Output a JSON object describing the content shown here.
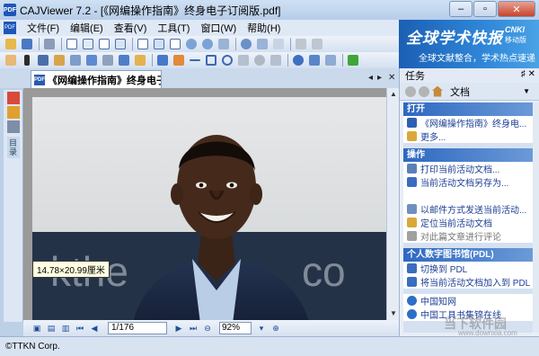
{
  "window": {
    "title": "CAJViewer 7.2 - [《网编操作指南》终身电子订阅版.pdf]",
    "buttons": {
      "minimize": "–",
      "maximize": "▫",
      "close": "✕"
    }
  },
  "menu": [
    "文件(F)",
    "编辑(E)",
    "查看(V)",
    "工具(T)",
    "窗口(W)",
    "帮助(H)"
  ],
  "banner": {
    "title": "全球学术快报",
    "cnki": "CNKI",
    "mobile": "移动版",
    "subtitle": "全球文献整合，学术热点速递"
  },
  "document_tab": {
    "label": "《网编操作指南》终身电子...",
    "close": "✕"
  },
  "left_bar": {
    "label": "目录"
  },
  "tooltip": "14.78×20.99厘米",
  "navigation": {
    "page_value": "1/176",
    "zoom_value": "92%"
  },
  "status": "©TTKN Corp.",
  "watermark": {
    "text": "当下软件园",
    "url": "www.downxia.com"
  },
  "task_pane": {
    "title": "任务",
    "pin": "♯ ✕",
    "dropdown_value": "文档",
    "sections": [
      {
        "header": "打开",
        "items": [
          {
            "label": "《网编操作指南》终身电...",
            "color": "#2e5fb4"
          },
          {
            "label": "更多...",
            "color": "#d9a83a"
          }
        ]
      },
      {
        "header": "操作",
        "items": [
          {
            "label": "打印当前活动文档...",
            "color": "#5b7fb8"
          },
          {
            "label": "当前活动文档另存为...",
            "color": "#3c6cc2"
          },
          {
            "label": "",
            "color": ""
          },
          {
            "label": "以邮件方式发送当前活动...",
            "color": "#6f8fc0"
          },
          {
            "label": "定位当前活动文档",
            "color": "#d9a83a"
          },
          {
            "label": "对此篇文章进行评论",
            "color": "#a0a0a0"
          }
        ]
      },
      {
        "header": "个人数字图书馆(PDL)",
        "items": [
          {
            "label": "切换到 PDL",
            "color": "#3a6cc0"
          },
          {
            "label": "将当前活动文档加入到 PDL",
            "color": "#3a6cc0"
          }
        ]
      },
      {
        "header": "",
        "items": [
          {
            "label": "中国知网",
            "color": "#2d6ec8"
          },
          {
            "label": "中国工具书集锦在线",
            "color": "#2d6ec8"
          }
        ]
      }
    ]
  }
}
